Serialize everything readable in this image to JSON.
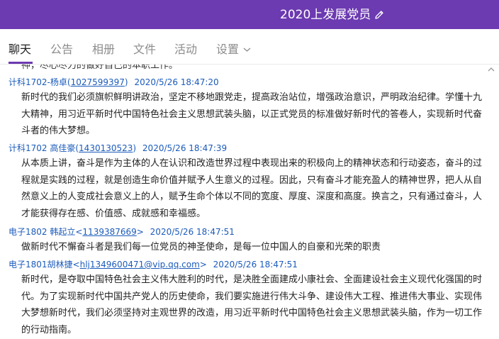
{
  "window": {
    "title": "2020上发展党员"
  },
  "tabs": [
    {
      "label": "聊天"
    },
    {
      "label": "公告"
    },
    {
      "label": "相册"
    },
    {
      "label": "文件"
    },
    {
      "label": "活动"
    },
    {
      "label": "设置"
    }
  ],
  "chat": {
    "cut_line": "神，尽心尽力的做好自己的本职工作。",
    "messages": [
      {
        "sender": "计科1702-杨卓(",
        "contact": "1027599397",
        "close": ")",
        "time": "2020/5/26 18:47:20",
        "text": "新时代的我们必须旗帜鲜明讲政治，坚定不移地跟党走，提高政治站位，增强政治意识，严明政治纪律。学懂十九大精神，用习近平新时代中国特色社会主义思想武装头脑，以正式党员的标准做好新时代的答卷人，实现新时代奋斗者的伟大梦想。"
      },
      {
        "sender": "计科1702 高佳豪(",
        "contact": "1430130523",
        "close": ")",
        "time": "2020/5/26 18:47:39",
        "text": "从本质上讲，奋斗是作为主体的人在认识和改造世界过程中表现出来的积极向上的精神状态和行动姿态，奋斗的过程就是实践的过程，就是创造生命价值并赋予人生意义的过程。因此，只有奋斗才能充盈人的精神世界，把人从自然意义上的人变成社会意义上的人，赋予生命个体以不同的宽度、厚度、深度和高度。换言之，只有通过奋斗，人才能获得存在感、价值感、成就感和幸福感。"
      },
      {
        "sender": "电子1802 韩起立<",
        "contact": "1139387669",
        "close": ">",
        "time": "2020/5/26 18:47:51",
        "text": "做新时代不懈奋斗者是我们每一位党员的神圣使命，是每一位中国人的自豪和光荣的职责"
      },
      {
        "sender": "电子1801胡林捷<",
        "contact": "hlj1349600471@vip.qq.com",
        "close": ">",
        "time": "2020/5/26 18:47:51",
        "text": "新时代，是夺取中国特色社会主义伟大胜利的时代，是决胜全面建成小康社会、全面建设社会主义现代化强国的时代。为了实现新时代中国共产党人的历史使命，我们要实施进行伟大斗争、建设伟大工程、推进伟大事业、实现伟大梦想新时代，我们必须坚持对主观世界的改造，用习近平新时代中国特色社会主义思想武装头脑，作为一切工作的行动指南。"
      }
    ]
  },
  "colors": {
    "titlebar": "#6c3ab1",
    "sender_link": "#1b5bbb",
    "active_tab": "#222222",
    "inactive_tab": "#8c8c8c"
  },
  "icons": {
    "edit": "pencil-icon",
    "settings_dropdown": "chevron-down-icon",
    "scroll": "chevron-up-icon"
  }
}
